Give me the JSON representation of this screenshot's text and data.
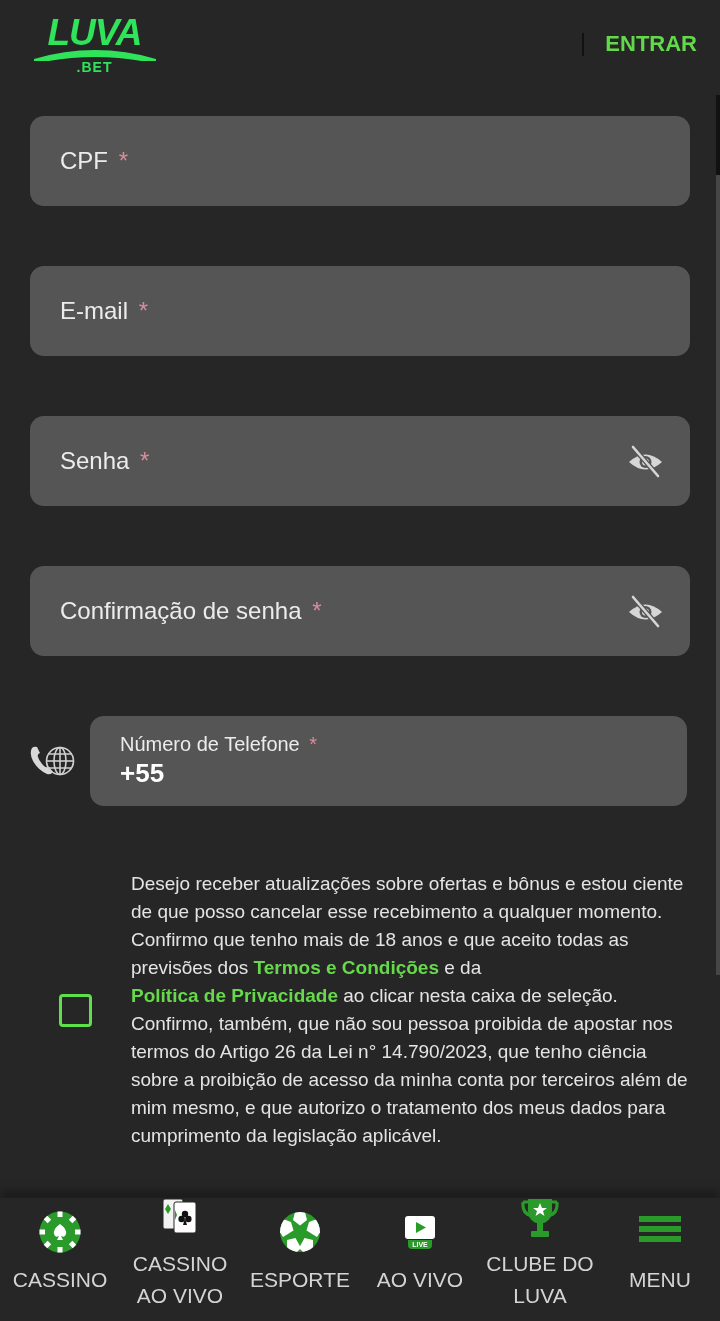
{
  "header": {
    "logo": {
      "wordmark": "LUVA",
      "suffix": ".BET"
    },
    "login_link": "ENTRAR"
  },
  "form": {
    "fields": [
      {
        "kind": "text",
        "label": "CPF",
        "required_mark": "*"
      },
      {
        "kind": "text",
        "label": "E-mail",
        "required_mark": "*"
      },
      {
        "kind": "password",
        "label": "Senha",
        "required_mark": "*"
      },
      {
        "kind": "password",
        "label": "Confirmação de senha",
        "required_mark": "*"
      },
      {
        "kind": "phone",
        "label": "Número de Telefone",
        "required_mark": "*",
        "value": "+55"
      }
    ],
    "consent": {
      "checked": false,
      "parts": [
        {
          "kind": "text",
          "text": "Desejo receber atualizações sobre ofertas e bônus e estou ciente de que posso cancelar esse recebimento a qualquer momento. Confirmo que tenho mais de 18 anos e que aceito todas as previsões dos "
        },
        {
          "kind": "link",
          "text": "Termos e Condições"
        },
        {
          "kind": "text",
          "text": " e da "
        },
        {
          "kind": "link",
          "text": "Política de Privacidade"
        },
        {
          "kind": "text",
          "text": " ao clicar nesta caixa de seleção. Confirmo, também, que não sou pessoa proibida de apostar nos termos do Artigo 26 da Lei n° 14.790/2023, que tenho ciência sobre a proibição de acesso da minha conta por terceiros além de mim mesmo, e que autorizo o tratamento dos meus dados para cumprimento da legislação aplicável."
        }
      ]
    }
  },
  "bottom_nav": {
    "items": [
      {
        "label": "CASSINO"
      },
      {
        "label": "CASSINO AO VIVO"
      },
      {
        "label": "ESPORTE"
      },
      {
        "label": "AO VIVO",
        "icon_badge": "LIVE"
      },
      {
        "label": "CLUBE DO LUVA"
      },
      {
        "label": "MENU"
      }
    ]
  }
}
